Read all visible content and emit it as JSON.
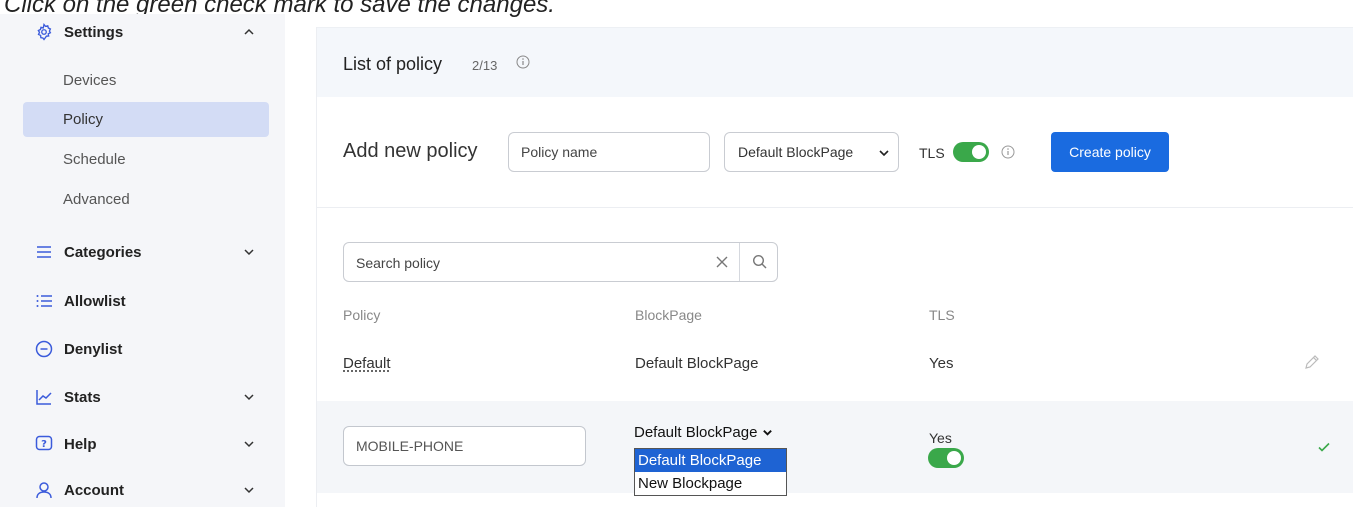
{
  "instruction": "Click on the green check mark to save the changes.",
  "sidebar": {
    "settings_label": "Settings",
    "sub_items": [
      {
        "label": "Devices",
        "active": false
      },
      {
        "label": "Policy",
        "active": true
      },
      {
        "label": "Schedule",
        "active": false
      },
      {
        "label": "Advanced",
        "active": false
      }
    ],
    "categories_label": "Categories",
    "allowlist_label": "Allowlist",
    "denylist_label": "Denylist",
    "stats_label": "Stats",
    "help_label": "Help",
    "account_label": "Account"
  },
  "header": {
    "title": "List of policy",
    "count": "2/13"
  },
  "add_policy": {
    "label": "Add new policy",
    "name_placeholder": "Policy name",
    "blockpage_value": "Default BlockPage",
    "tls_label": "TLS",
    "tls_enabled": true,
    "create_label": "Create policy"
  },
  "search": {
    "placeholder": "Search policy"
  },
  "table": {
    "columns": [
      "Policy",
      "BlockPage",
      "TLS"
    ],
    "rows": [
      {
        "policy": "Default",
        "blockpage": "Default BlockPage",
        "tls": "Yes"
      }
    ],
    "editing_row": {
      "policy_value": "MOBILE-PHONE",
      "blockpage_value": "Default BlockPage",
      "blockpage_options": [
        "Default BlockPage",
        "New Blockpage"
      ],
      "selected_option": "Default BlockPage",
      "tls": "Yes",
      "tls_enabled": true
    }
  },
  "colors": {
    "accent_blue": "#1a6be0",
    "toggle_green": "#3aa84a",
    "active_nav": "#d3dcf5"
  }
}
